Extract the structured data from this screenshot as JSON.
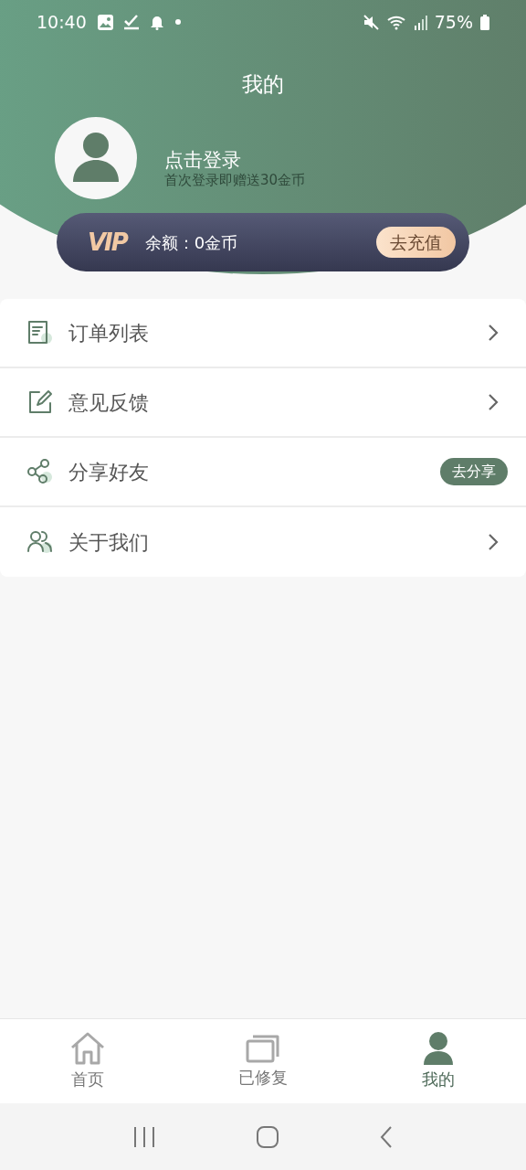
{
  "status_bar": {
    "time": "10:40",
    "battery": "75%"
  },
  "title": "我的",
  "profile": {
    "name": "点击登录",
    "hint": "首次登录即赠送30金币"
  },
  "vip": {
    "logo": "VIP",
    "balance": "余额：0金币",
    "button": "去充值"
  },
  "menu": [
    {
      "kind": "orders",
      "label": "订单列表"
    },
    {
      "kind": "feedback",
      "label": "意见反馈"
    },
    {
      "kind": "share",
      "label": "分享好友",
      "action": "去分享"
    },
    {
      "kind": "about",
      "label": "关于我们"
    }
  ],
  "bottom_nav": [
    {
      "kind": "home",
      "label": "首页",
      "selected": false
    },
    {
      "kind": "repaired",
      "label": "已修复",
      "selected": false
    },
    {
      "kind": "me",
      "label": "我的",
      "selected": true
    }
  ]
}
